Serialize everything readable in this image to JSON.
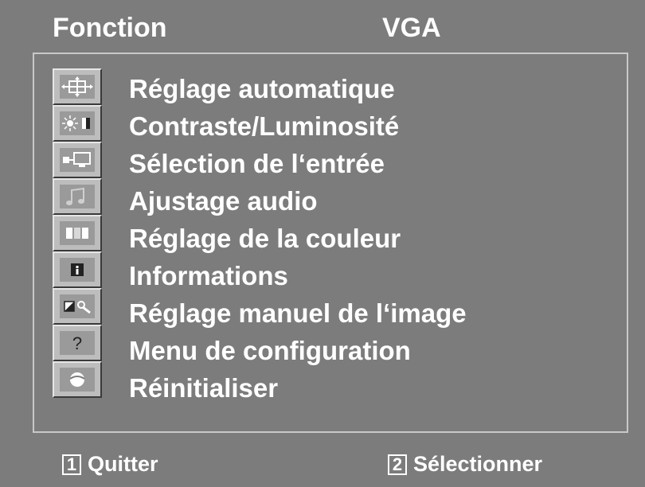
{
  "header": {
    "function_label": "Fonction",
    "source_label": "VGA"
  },
  "menu": {
    "items": [
      {
        "label": "Réglage automatique",
        "icon": "auto-adjust-icon"
      },
      {
        "label": "Contraste/Luminosité",
        "icon": "brightness-contrast-icon"
      },
      {
        "label": "Sélection de l‘entrée",
        "icon": "input-select-icon"
      },
      {
        "label": "Ajustage audio",
        "icon": "audio-icon"
      },
      {
        "label": "Réglage de la couleur",
        "icon": "color-icon"
      },
      {
        "label": "Informations",
        "icon": "info-icon"
      },
      {
        "label": "Réglage manuel de l‘image",
        "icon": "manual-image-icon"
      },
      {
        "label": "Menu de configuration",
        "icon": "setup-help-icon"
      },
      {
        "label": "Réinitialiser",
        "icon": "reset-icon"
      }
    ]
  },
  "footer": {
    "exit_key": "1",
    "exit_label": "Quitter",
    "select_key": "2",
    "select_label": "Sélectionner"
  },
  "colors": {
    "background": "#7c7c7c",
    "text": "#ffffff",
    "icon_face": "#9a9a9a"
  }
}
